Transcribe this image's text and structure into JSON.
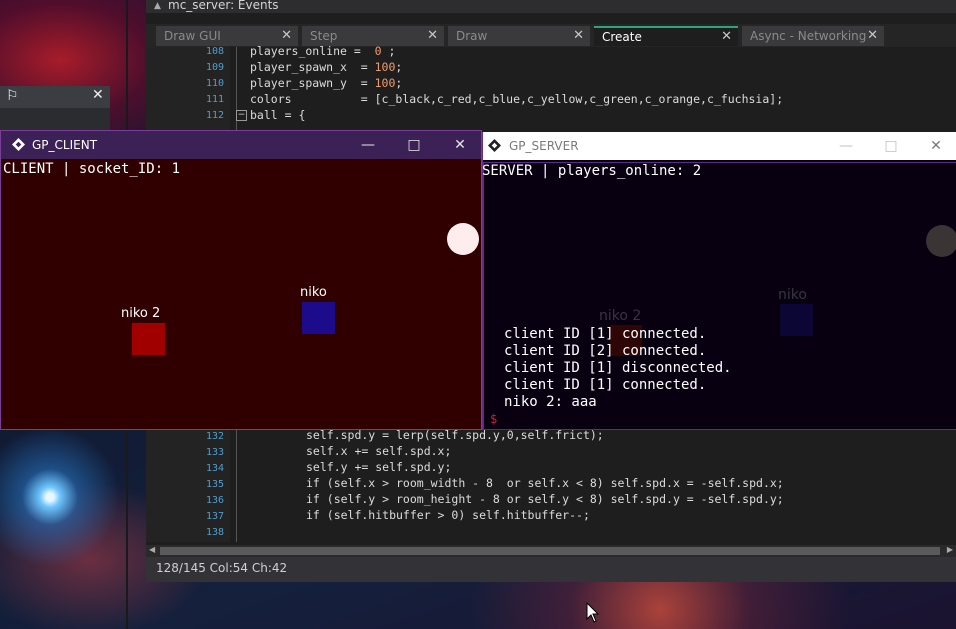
{
  "ide": {
    "title": "mc_server: Events",
    "tabs": [
      {
        "label": "Draw GUI",
        "active": false
      },
      {
        "label": "Step",
        "active": false
      },
      {
        "label": "Draw",
        "active": false
      },
      {
        "label": "Create",
        "active": true
      },
      {
        "label": "Async - Networking",
        "active": false
      }
    ],
    "code_top": [
      {
        "line": "108",
        "text": "players_online =  0 ;"
      },
      {
        "line": "109",
        "text": "player_spawn_x  = 100;"
      },
      {
        "line": "110",
        "text": "player_spawn_y  = 100;"
      },
      {
        "line": "111",
        "text": "colors          = [c_black,c_red,c_blue,c_yellow,c_green,c_orange,c_fuchsia];"
      },
      {
        "line": "112",
        "text": "ball = {"
      }
    ],
    "code_bottom": [
      {
        "line": "132",
        "text": "self.spd.y = lerp(self.spd.y,0,self.frict);"
      },
      {
        "line": "133",
        "text": "self.x += self.spd.x;"
      },
      {
        "line": "134",
        "text": "self.y += self.spd.y;"
      },
      {
        "line": "135",
        "text": "if (self.x > room_width - 8  or self.x < 8) self.spd.x = -self.spd.x;"
      },
      {
        "line": "136",
        "text": "if (self.y > room_height - 8 or self.y < 8) self.spd.y = -self.spd.y;"
      },
      {
        "line": "137",
        "text": "if (self.hitbuffer > 0) self.hitbuffer--;"
      },
      {
        "line": "138",
        "text": ""
      }
    ],
    "status": "128/145 Col:54 Ch:42"
  },
  "client": {
    "title": "GP_CLIENT",
    "header": "CLIENT | socket_ID: 1",
    "player_red_label": "niko 2",
    "player_blue_label": "niko",
    "colors": {
      "background": "#300000",
      "red_player": "#a00000",
      "blue_player": "#1c0c8c",
      "ball": "#ffecec"
    }
  },
  "server": {
    "title": "GP_SERVER",
    "header": "SERVER | players_online: 2",
    "player_red_label": "niko 2",
    "player_blue_label": "niko",
    "log": [
      "client ID [1] connected.",
      "client ID [2] connected.",
      "client ID [1] disconnected.",
      "client ID [1] connected.",
      "niko 2: aaa"
    ],
    "prompt": "$"
  },
  "icons": {
    "flag": "flag-icon",
    "window_minimize": "—",
    "window_maximize": "□",
    "window_close": "✕"
  }
}
